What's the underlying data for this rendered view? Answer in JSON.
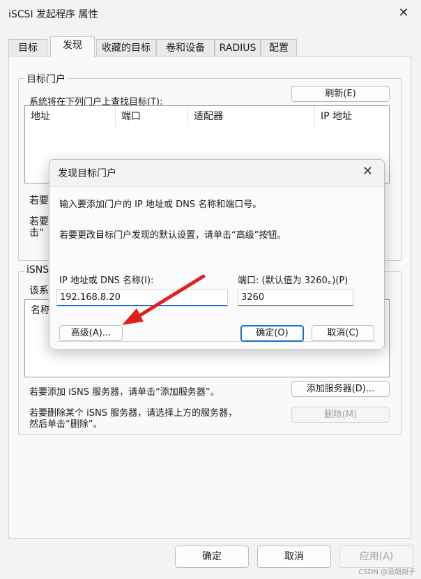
{
  "window": {
    "title": "iSCSI 发起程序 属性",
    "close": "✕"
  },
  "tabs": [
    "目标",
    "发现",
    "收藏的目标",
    "卷和设备",
    "RADIUS",
    "配置"
  ],
  "portal_group": {
    "label": "目标门户",
    "find_label": "系统将在下列门户上查找目标(T):",
    "refresh_button": "刷新(E)",
    "columns": [
      "地址",
      "端口",
      "适配器",
      "IP 地址"
    ],
    "add_hint_partial": "若要",
    "remove_hint_partial_1": "若要",
    "remove_hint_partial_2": "击“"
  },
  "isns_group": {
    "label": "iSNS",
    "desc_partial": "该系",
    "column_partial": "名称",
    "add_hint": "若要添加 iSNS 服务器，请单击“添加服务器”。",
    "add_button": "添加服务器(D)...",
    "remove_hint_1": "若要删除某个 iSNS 服务器，请选择上方的服务器，",
    "remove_hint_2": "然后单击“删除”。",
    "remove_button": "删除(M)"
  },
  "dialog": {
    "title": "发现目标门户",
    "close": "✕",
    "intro": "输入要添加门户的 IP 地址或 DNS 名称和端口号。",
    "advanced_hint": "若要更改目标门户发现的默认设置，请单击“高级”按钮。",
    "ip_label": "IP 地址或 DNS 名称(I):",
    "ip_value": "192.168.8.20",
    "port_label": "端口: (默认值为 3260。)(P)",
    "port_value": "3260",
    "advanced_button": "高级(A)...",
    "ok_button": "确定(O)",
    "cancel_button": "取消(C)"
  },
  "footer": {
    "ok": "确定",
    "cancel": "取消",
    "apply": "应用(A)"
  },
  "watermark": "CSDN @没胡胡子",
  "colors": {
    "accent": "#1a6fd1",
    "arrow": "#e02020"
  }
}
